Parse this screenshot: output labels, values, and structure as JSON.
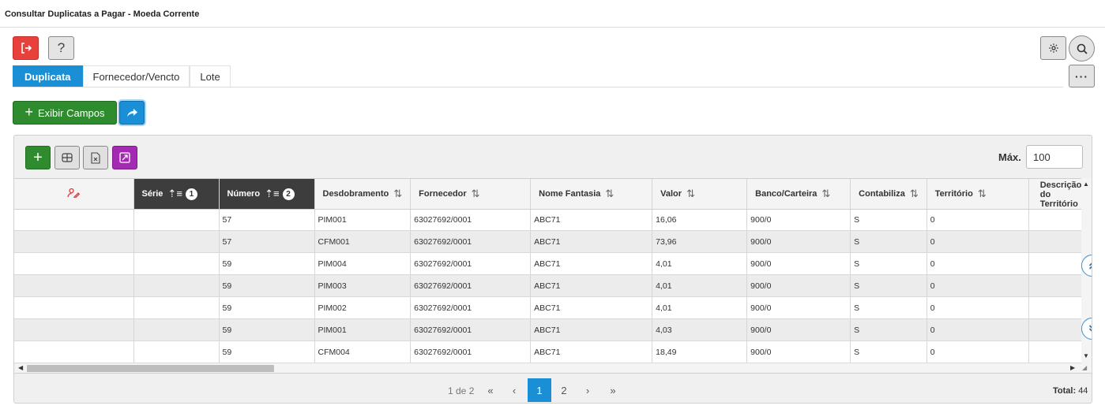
{
  "window": {
    "title": "Consultar Duplicatas a Pagar - Moeda Corrente"
  },
  "toolbar": {
    "help_label": "?",
    "more_label": "···"
  },
  "tabs": [
    {
      "label": "Duplicata",
      "active": true
    },
    {
      "label": "Fornecedor/Vencto",
      "active": false
    },
    {
      "label": "Lote",
      "active": false
    }
  ],
  "actions": {
    "exibir_label": "Exibir Campos"
  },
  "grid": {
    "max_label": "Máx.",
    "max_value": "100",
    "columns": {
      "serie": "Série",
      "serie_order": "1",
      "numero": "Número",
      "numero_order": "2",
      "desdobramento": "Desdobramento",
      "fornecedor": "Fornecedor",
      "nome_fantasia": "Nome Fantasia",
      "valor": "Valor",
      "banco": "Banco/Carteira",
      "contabiliza": "Contabiliza",
      "territorio": "Território",
      "descricao": "Descrição do Território"
    },
    "rows": [
      {
        "serie": "",
        "numero": "57",
        "desdobramento": "PIM001",
        "fornecedor": "63027692/0001",
        "nome_fantasia": "ABC71",
        "valor": "16,06",
        "banco": "900/0",
        "contabiliza": "S",
        "territorio": "0",
        "descricao": ""
      },
      {
        "serie": "",
        "numero": "57",
        "desdobramento": "CFM001",
        "fornecedor": "63027692/0001",
        "nome_fantasia": "ABC71",
        "valor": "73,96",
        "banco": "900/0",
        "contabiliza": "S",
        "territorio": "0",
        "descricao": ""
      },
      {
        "serie": "",
        "numero": "59",
        "desdobramento": "PIM004",
        "fornecedor": "63027692/0001",
        "nome_fantasia": "ABC71",
        "valor": "4,01",
        "banco": "900/0",
        "contabiliza": "S",
        "territorio": "0",
        "descricao": ""
      },
      {
        "serie": "",
        "numero": "59",
        "desdobramento": "PIM003",
        "fornecedor": "63027692/0001",
        "nome_fantasia": "ABC71",
        "valor": "4,01",
        "banco": "900/0",
        "contabiliza": "S",
        "territorio": "0",
        "descricao": ""
      },
      {
        "serie": "",
        "numero": "59",
        "desdobramento": "PIM002",
        "fornecedor": "63027692/0001",
        "nome_fantasia": "ABC71",
        "valor": "4,01",
        "banco": "900/0",
        "contabiliza": "S",
        "territorio": "0",
        "descricao": ""
      },
      {
        "serie": "",
        "numero": "59",
        "desdobramento": "PIM001",
        "fornecedor": "63027692/0001",
        "nome_fantasia": "ABC71",
        "valor": "4,03",
        "banco": "900/0",
        "contabiliza": "S",
        "territorio": "0",
        "descricao": ""
      },
      {
        "serie": "",
        "numero": "59",
        "desdobramento": "CFM004",
        "fornecedor": "63027692/0001",
        "nome_fantasia": "ABC71",
        "valor": "18,49",
        "banco": "900/0",
        "contabiliza": "S",
        "territorio": "0",
        "descricao": ""
      }
    ]
  },
  "pager": {
    "info": "1 de 2",
    "first": "«",
    "prev": "‹",
    "pages": [
      "1",
      "2"
    ],
    "next": "›",
    "last": "»",
    "total_label": "Total:",
    "total_value": "44"
  },
  "colors": {
    "accent": "#1a8fd6",
    "success": "#2e8b2e",
    "danger": "#e8413c",
    "purple": "#a52ab3"
  }
}
